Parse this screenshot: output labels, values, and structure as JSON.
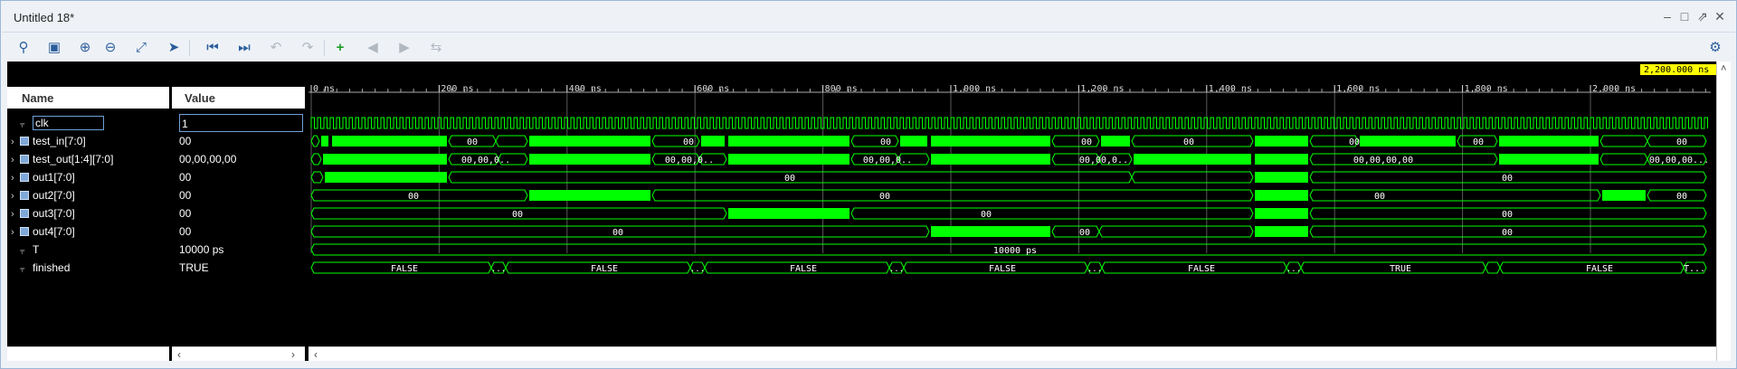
{
  "window": {
    "title": "Untitled 18*"
  },
  "toolbar": {
    "icons": [
      "search-icon",
      "save-icon",
      "zoom-in-icon",
      "zoom-out-icon",
      "zoom-fit-icon",
      "go-to-cursor-icon",
      "go-to-start-icon",
      "go-to-end-icon",
      "previous-transition-icon",
      "next-transition-icon",
      "add-marker-icon",
      "previous-marker-icon",
      "next-marker-icon",
      "swap-cursors-icon",
      "settings-icon"
    ]
  },
  "names_panel": {
    "header": "Name"
  },
  "values_panel": {
    "header": "Value"
  },
  "signals": [
    {
      "name": "clk",
      "value": "1",
      "kind": "bit",
      "expandable": false
    },
    {
      "name": "test_in[7:0]",
      "value": "00",
      "kind": "bus",
      "expandable": true
    },
    {
      "name": "test_out[1:4][7:0]",
      "value": "00,00,00,00",
      "kind": "bus",
      "expandable": true
    },
    {
      "name": "out1[7:0]",
      "value": "00",
      "kind": "bus",
      "expandable": true
    },
    {
      "name": "out2[7:0]",
      "value": "00",
      "kind": "bus",
      "expandable": true
    },
    {
      "name": "out3[7:0]",
      "value": "00",
      "kind": "bus",
      "expandable": true
    },
    {
      "name": "out4[7:0]",
      "value": "00",
      "kind": "bus",
      "expandable": true
    },
    {
      "name": "T",
      "value": "10000 ps",
      "kind": "bit",
      "expandable": false
    },
    {
      "name": "finished",
      "value": "TRUE",
      "kind": "bit",
      "expandable": false
    }
  ],
  "timeline": {
    "ticks": [
      "0 ns",
      "200 ns",
      "400 ns",
      "600 ns",
      "800 ns",
      "1,000 ns",
      "1,200 ns",
      "1,400 ns",
      "1,600 ns",
      "1,800 ns",
      "2,000 ns"
    ],
    "cursor_label": "2,200.000 ns"
  },
  "wave_labels": {
    "test_in": [
      "00",
      "00",
      "00",
      "00",
      "00",
      "00",
      "00"
    ],
    "test_out": [
      "00,00,0..",
      "00,00,0..",
      "00,00,0..",
      "00,00,0..",
      "00,00,00,00",
      "00,00,00..."
    ],
    "out1": [
      "00",
      "00"
    ],
    "out2": [
      "00",
      "00",
      "00",
      "00"
    ],
    "out3": [
      "00",
      "00",
      "00"
    ],
    "out4": [
      "00",
      "00",
      "00"
    ],
    "T": [
      "10000 ps"
    ],
    "finished": [
      "FALSE",
      "FALSE",
      "FALSE",
      "FALSE",
      "FALSE",
      "TRUE",
      "FALSE",
      "T..."
    ],
    "ellipsis": "..."
  },
  "colors": {
    "wave": "#00ff00",
    "cursor_label_bg": "#ffff00",
    "background": "#000000"
  }
}
